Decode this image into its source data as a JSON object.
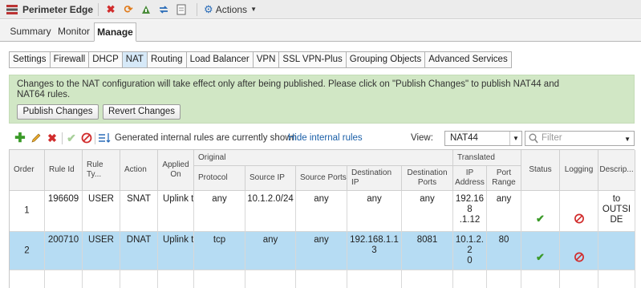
{
  "window": {
    "title": "Perimeter Edge",
    "actions_label": "Actions"
  },
  "main_tabs": [
    {
      "label": "Summary"
    },
    {
      "label": "Monitor"
    },
    {
      "label": "Manage",
      "active": true
    }
  ],
  "sub_tabs": [
    {
      "label": "Settings"
    },
    {
      "label": "Firewall"
    },
    {
      "label": "DHCP"
    },
    {
      "label": "NAT",
      "active": true
    },
    {
      "label": "Routing"
    },
    {
      "label": "Load Balancer"
    },
    {
      "label": "VPN"
    },
    {
      "label": "SSL VPN-Plus"
    },
    {
      "label": "Grouping Objects"
    },
    {
      "label": "Advanced Services"
    }
  ],
  "notice": {
    "text": "Changes to the NAT configuration will take effect only after being published. Please click on \"Publish Changes\" to publish NAT44 and NAT64 rules.",
    "publish_label": "Publish Changes",
    "revert_label": "Revert Changes"
  },
  "toolbar": {
    "status_text": "Generated internal rules are currently shown",
    "hide_link": "Hide internal rules",
    "view_label": "View:",
    "view_value": "NAT44",
    "filter_placeholder": "Filter",
    "icons": [
      "add-icon",
      "edit-icon",
      "delete-icon",
      "enable-icon",
      "disable-icon",
      "reorder-icon"
    ]
  },
  "grid": {
    "group_headers": {
      "original": "Original",
      "translated": "Translated"
    },
    "columns": {
      "order": "Order",
      "rule_id": "Rule Id",
      "rule_type": "Rule Ty...",
      "action": "Action",
      "applied_on": "Applied On",
      "protocol": "Protocol",
      "source_ip": "Source IP",
      "source_ports": "Source Ports",
      "destination_ip": "Destination IP",
      "destination_ports": "Destination Ports",
      "ip_address": "IP Address",
      "port_range": "Port Range",
      "status": "Status",
      "logging": "Logging",
      "description": "Descrip..."
    },
    "rows": [
      {
        "order": "1",
        "rule_id": "196609",
        "rule_type": "USER",
        "action": "SNAT",
        "applied_on": "Uplink to",
        "protocol": "any",
        "source_ip": "10.1.2.0/24",
        "source_ports": "any",
        "destination_ip": "any",
        "destination_ports": "any",
        "ip_address": "192.168\n.1.12",
        "port_range": "any",
        "status": "enabled",
        "logging": "disabled",
        "description": "to\nOUTSI\nDE",
        "selected": false
      },
      {
        "order": "2",
        "rule_id": "200710",
        "rule_type": "USER",
        "action": "DNAT",
        "applied_on": "Uplink to",
        "protocol": "tcp",
        "source_ip": "any",
        "source_ports": "any",
        "destination_ip": "192.168.1.1\n3",
        "destination_ports": "8081",
        "ip_address": "10.1.2.2\n0",
        "port_range": "80",
        "status": "enabled",
        "logging": "disabled",
        "description": "",
        "selected": true
      }
    ]
  },
  "colors": {
    "notice_bg": "#d1e7c5",
    "selected_row": "#b6dcf3",
    "link": "#1a5fa8",
    "check_green": "#3a9a28",
    "deny_red": "#d12c2c"
  }
}
